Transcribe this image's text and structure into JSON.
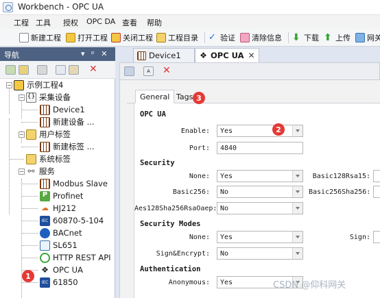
{
  "window": {
    "title": "Workbench - OPC UA"
  },
  "menu": [
    "工程",
    "工具",
    "授权",
    "OPC DA",
    "查看",
    "帮助"
  ],
  "toolbar": {
    "new_project": "新建工程",
    "open_project": "打开工程",
    "close_project": "关闭工程",
    "project_dir": "工程目录",
    "verify": "验证",
    "clear_info": "清除信息",
    "download": "下载",
    "upload": "上传",
    "gateway": "网关"
  },
  "nav": {
    "title": "导航",
    "pin": "▾ ᵖ ✕",
    "tree": {
      "root": "示例工程4",
      "collect": "采集设备",
      "device1": "Device1",
      "new_device": "新建设备 ...",
      "user_tags": "用户标签",
      "new_tag": "新建标签 ...",
      "sys_tags": "系统标签",
      "services": "服务",
      "svc": [
        "Modbus Slave",
        "Profinet",
        "HJ212",
        "60870-5-104",
        "BACnet",
        "SL651",
        "HTTP REST API",
        "OPC UA",
        "61850"
      ]
    }
  },
  "doc_tabs": {
    "device1": "Device1",
    "opcua": "OPC UA",
    "close": "✕"
  },
  "panel": {
    "tab_general": "General",
    "tab_tags": "Tags",
    "sections": {
      "opcua": "OPC UA",
      "security": "Security",
      "security_modes": "Security Modes",
      "auth": "Authentication"
    },
    "fields": {
      "enable_label": "Enable:",
      "enable_value": "Yes",
      "port_label": "Port:",
      "port_value": "4840",
      "none_label": "None:",
      "none_value": "Yes",
      "basic128_label": "Basic128Rsa15:",
      "basic256_label": "Basic256:",
      "basic256_value": "No",
      "basic256sha_label": "Basic256Sha256:",
      "aes_label": "Aes128Sha256RsaOaep:",
      "aes_value": "No",
      "mode_none_label": "None:",
      "mode_none_value": "Yes",
      "sign_label": "Sign:",
      "sign_encrypt_label": "Sign&Encrypt:",
      "sign_encrypt_value": "No",
      "anonymous_label": "Anonymous:",
      "anonymous_value": "Yes"
    }
  },
  "badges": {
    "b1": "1",
    "b2": "2",
    "b3": "3"
  },
  "watermark": "CSDN @仰科网关",
  "colors": {
    "nav_header": "#4d6182",
    "badge": "#e53935",
    "selected_tab": "#ffffff"
  }
}
